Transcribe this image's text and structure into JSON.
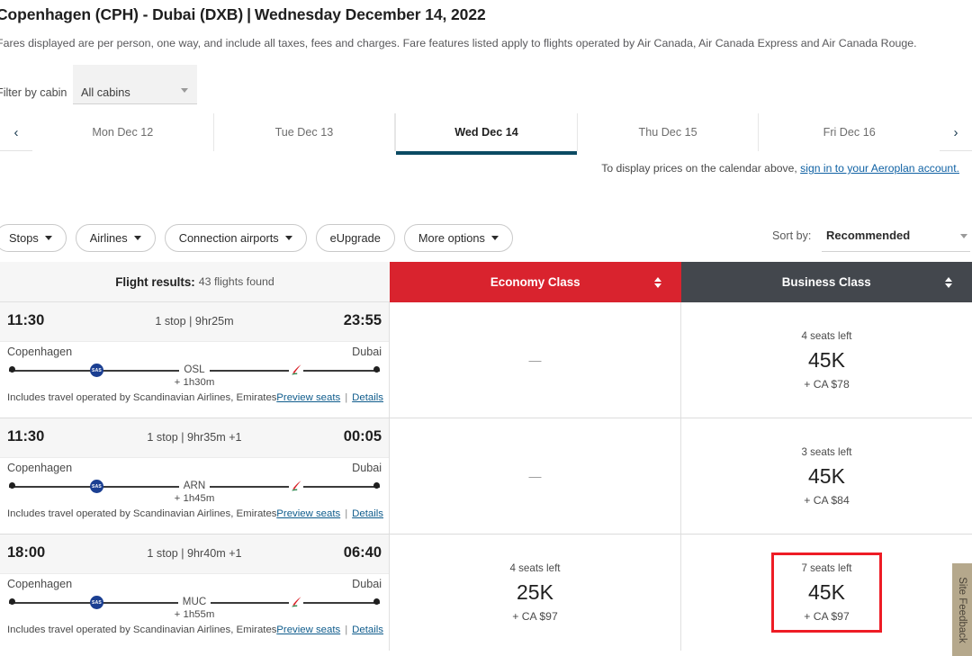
{
  "header": {
    "route": "Copenhagen (CPH) - Dubai (DXB)",
    "separator": "|",
    "date": "Wednesday December 14, 2022",
    "disclaimer": "Fares displayed are per person, one way, and include all taxes, fees and charges. Fare features listed apply to flights operated by Air Canada, Air Canada Express and Air Canada Rouge."
  },
  "cabin_filter": {
    "label": "Filter by cabin",
    "value": "All cabins",
    "options": [
      "All cabins"
    ]
  },
  "date_tabs": {
    "prev_arrow": "‹",
    "next_arrow": "›",
    "items": [
      {
        "label": "Mon Dec 12",
        "active": false
      },
      {
        "label": "Tue Dec 13",
        "active": false
      },
      {
        "label": "Wed Dec 14",
        "active": true
      },
      {
        "label": "Thu Dec 15",
        "active": false
      },
      {
        "label": "Fri Dec 16",
        "active": false
      }
    ],
    "signin_prefix": "To display prices on the calendar above, ",
    "signin_link": "sign in to your Aeroplan account."
  },
  "filters": {
    "chips": [
      {
        "label": "Stops",
        "has_caret": true
      },
      {
        "label": "Airlines",
        "has_caret": true
      },
      {
        "label": "Connection airports",
        "has_caret": true
      },
      {
        "label": "eUpgrade",
        "has_caret": false
      },
      {
        "label": "More options",
        "has_caret": true
      }
    ],
    "sort_label": "Sort by:",
    "sort_value": "Recommended"
  },
  "table": {
    "results_label": "Flight results:",
    "results_count": "43 flights found",
    "columns": [
      {
        "label": "Economy Class",
        "color": "#d9232e"
      },
      {
        "label": "Business Class",
        "color": "#43474d"
      }
    ]
  },
  "flights": [
    {
      "depart_time": "11:30",
      "duration": "1 stop | 9hr25m",
      "arrive_time": "23:55",
      "origin_city": "Copenhagen",
      "destination_city": "Dubai",
      "stop_code": "OSL",
      "layover": "+ 1h30m",
      "operated_by": "Includes travel operated by Scandinavian Airlines, Emirates",
      "preview_seats": "Preview seats",
      "details": "Details",
      "economy": {
        "available": false,
        "placeholder": "—"
      },
      "business": {
        "available": true,
        "seats_left": "4 seats left",
        "points": "45K",
        "cash": "+ CA $78",
        "highlighted": false
      }
    },
    {
      "depart_time": "11:30",
      "duration": "1 stop | 9hr35m +1",
      "arrive_time": "00:05",
      "origin_city": "Copenhagen",
      "destination_city": "Dubai",
      "stop_code": "ARN",
      "layover": "+ 1h45m",
      "operated_by": "Includes travel operated by Scandinavian Airlines, Emirates",
      "preview_seats": "Preview seats",
      "details": "Details",
      "economy": {
        "available": false,
        "placeholder": "—"
      },
      "business": {
        "available": true,
        "seats_left": "3 seats left",
        "points": "45K",
        "cash": "+ CA $84",
        "highlighted": false
      }
    },
    {
      "depart_time": "18:00",
      "duration": "1 stop | 9hr40m +1",
      "arrive_time": "06:40",
      "origin_city": "Copenhagen",
      "destination_city": "Dubai",
      "stop_code": "MUC",
      "layover": "+ 1h55m",
      "operated_by": "Includes travel operated by Scandinavian Airlines, Emirates",
      "preview_seats": "Preview seats",
      "details": "Details",
      "economy": {
        "available": true,
        "seats_left": "4 seats left",
        "points": "25K",
        "cash": "+ CA $97"
      },
      "business": {
        "available": true,
        "seats_left": "7 seats left",
        "points": "45K",
        "cash": "+ CA $97",
        "highlighted": true
      }
    }
  ],
  "feedback": {
    "label": "Site Feedback"
  },
  "icons": {
    "sas_logo": "SAS",
    "emirates_logo": "emirates-swoosh"
  }
}
